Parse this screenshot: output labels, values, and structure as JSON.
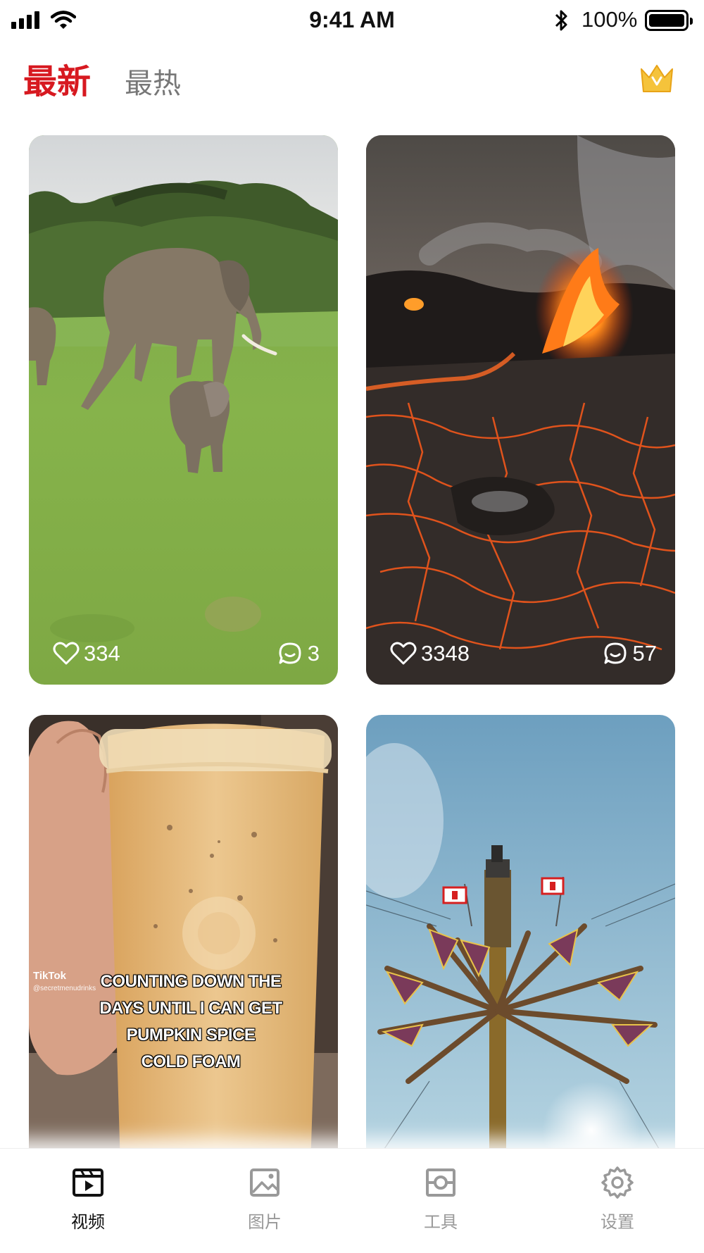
{
  "status_bar": {
    "time": "9:41 AM",
    "battery": "100%"
  },
  "header": {
    "tabs": [
      {
        "label": "最新",
        "active": true
      },
      {
        "label": "最热",
        "active": false
      }
    ],
    "vip_icon": "crown-icon"
  },
  "feed": {
    "items": [
      {
        "subject": "elephants",
        "likes": "334",
        "comments": "3"
      },
      {
        "subject": "lava",
        "likes": "3348",
        "comments": "57"
      },
      {
        "subject": "iced-coffee",
        "overlay_lines": [
          "COUNTING DOWN THE",
          "DAYS UNTIL I CAN GET",
          "PUMPKIN SPICE",
          "COLD FOAM"
        ],
        "watermark": "TikTok",
        "watermark_handle": "@secretmenudrinks"
      },
      {
        "subject": "swing-ride"
      }
    ]
  },
  "bottom_nav": {
    "items": [
      {
        "label": "视频",
        "icon": "video-icon",
        "active": true
      },
      {
        "label": "图片",
        "icon": "image-icon",
        "active": false
      },
      {
        "label": "工具",
        "icon": "tool-icon",
        "active": false
      },
      {
        "label": "设置",
        "icon": "settings-icon",
        "active": false
      }
    ]
  },
  "colors": {
    "accent": "#d71920",
    "vip": "#f2b824",
    "inactive": "#999999"
  }
}
